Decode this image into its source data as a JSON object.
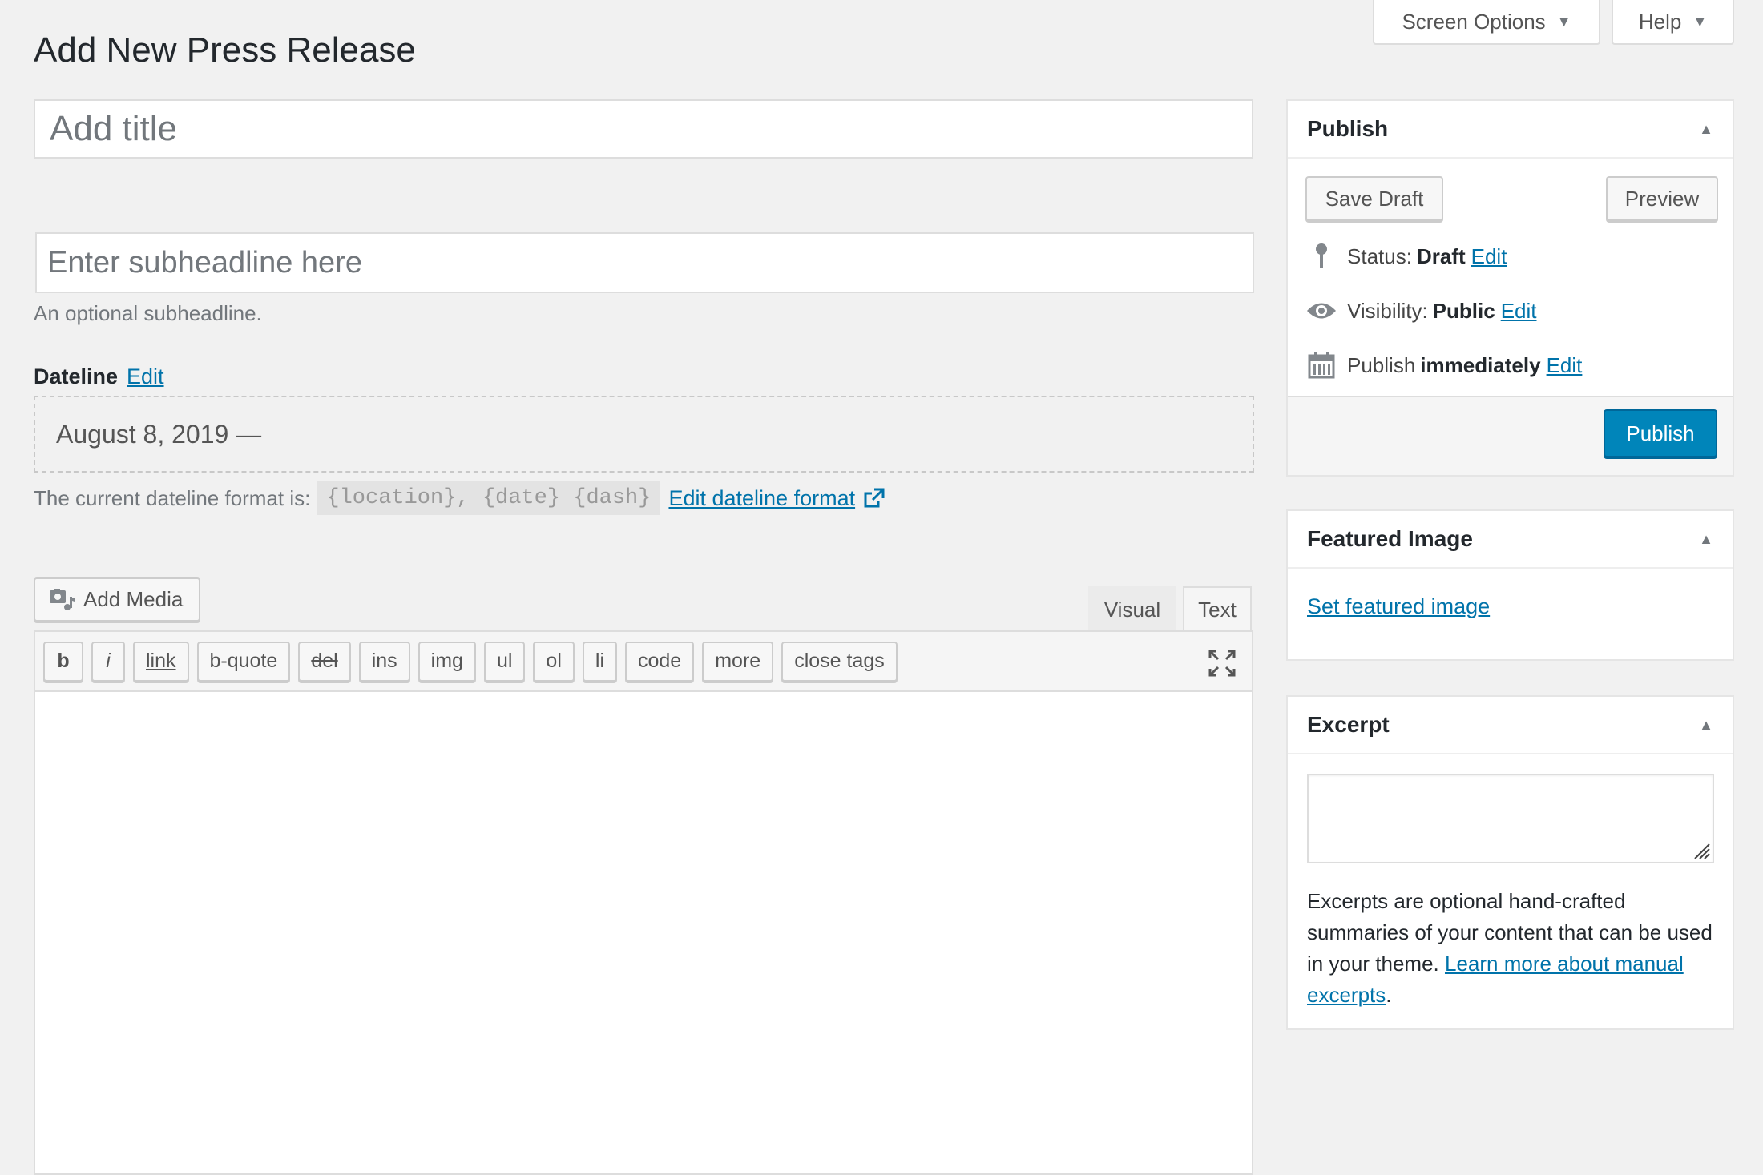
{
  "screen_meta": {
    "screen_options_label": "Screen Options",
    "help_label": "Help",
    "arrow": "▼"
  },
  "page": {
    "title": "Add New Press Release"
  },
  "title_field": {
    "placeholder": "Add title"
  },
  "subheadline": {
    "placeholder": "Enter subheadline here",
    "description": "An optional subheadline."
  },
  "dateline": {
    "label": "Dateline",
    "edit_label": "Edit",
    "value": "August 8, 2019 —",
    "format_prefix": "The current dateline format is:",
    "format_code": "{location}, {date} {dash}",
    "edit_format_label": "Edit dateline format"
  },
  "editor": {
    "add_media_label": "Add Media",
    "tabs": {
      "visual": "Visual",
      "text": "Text"
    },
    "quicktags": [
      "b",
      "i",
      "link",
      "b-quote",
      "del",
      "ins",
      "img",
      "ul",
      "ol",
      "li",
      "code",
      "more",
      "close tags"
    ],
    "content": ""
  },
  "publish_box": {
    "title": "Publish",
    "save_draft_label": "Save Draft",
    "preview_label": "Preview",
    "status_label": "Status:",
    "status_value": "Draft",
    "visibility_label": "Visibility:",
    "visibility_value": "Public",
    "schedule_label": "Publish",
    "schedule_value": "immediately",
    "edit_label": "Edit",
    "publish_button_label": "Publish"
  },
  "featured_image_box": {
    "title": "Featured Image",
    "set_label": "Set featured image"
  },
  "excerpt_box": {
    "title": "Excerpt",
    "value": "",
    "description": "Excerpts are optional hand-crafted summaries of your content that can be used in your theme.",
    "learn_more_label": "Learn more about manual excerpts",
    "trailing_period": "."
  },
  "icons": {
    "pin": "pin-icon",
    "eye": "eye-icon",
    "calendar": "calendar-icon",
    "media": "add-media-icon",
    "fullscreen": "fullscreen-icon",
    "external": "external-link-icon"
  },
  "colors": {
    "link": "#0073aa",
    "primary_button": "#0085ba",
    "background": "#f1f1f1"
  }
}
